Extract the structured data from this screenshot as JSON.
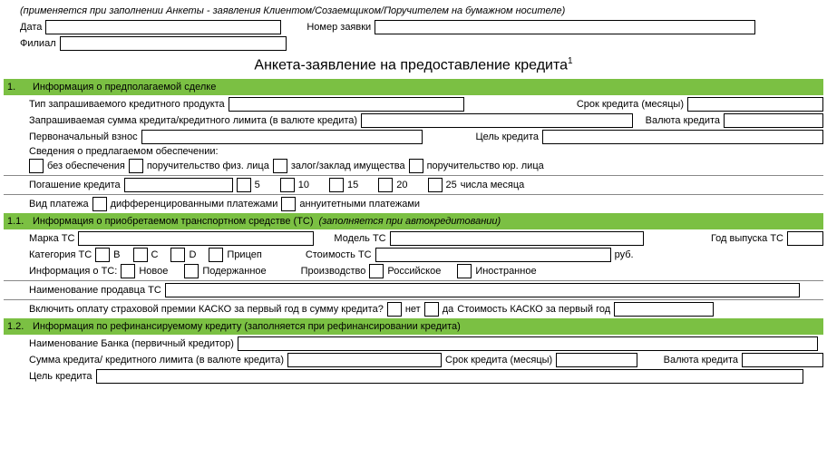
{
  "note_top": "(применяется при заполнении Анкеты - заявления Клиентом/Созаемщиком/Поручителем на бумажном носителе)",
  "header": {
    "date_label": "Дата",
    "app_number_label": "Номер заявки",
    "branch_label": "Филиал"
  },
  "title": "Анкета-заявление на предоставление кредита",
  "title_sup": "1",
  "section1": {
    "num": "1.",
    "label": "Информация о предполагаемой сделке",
    "product_type": "Тип запрашиваемого кредитного продукта",
    "loan_term": "Срок кредита (месяцы)",
    "req_amount": "Запрашиваемая сумма кредита/кредитного лимита (в валюте кредита)",
    "currency": "Валюта кредита",
    "down_payment": "Первоначальный взнос",
    "purpose": "Цель кредита",
    "collateral_info": "Сведения о предлагаемом обеспечении:",
    "no_collateral": "без обеспечения",
    "guarantee_person": "поручительство физ. лица",
    "pledge": "залог/заклад имущества",
    "guarantee_legal": "поручительство юр. лица",
    "repayment": "Погашение кредита",
    "day5": "5",
    "day10": "10",
    "day15": "15",
    "day20": "20",
    "day25": "25",
    "day_suffix": "числа месяца",
    "payment_type": "Вид платежа",
    "differentiated": "дифференцированными платежами",
    "annuity": "аннуитетными платежами"
  },
  "section11": {
    "num": "1.1.",
    "label": "Информация о приобретаемом транспортном средстве (ТС)",
    "note": "(заполняется при автокредитовании)",
    "brand": "Марка ТС",
    "model": "Модель ТС",
    "year": "Год выпуска ТС",
    "category": "Категория ТС",
    "catB": "B",
    "catC": "C",
    "catD": "D",
    "trailer": "Прицеп",
    "cost": "Стоимость ТС",
    "rub": "руб.",
    "info_tc": "Информация о ТС:",
    "new": "Новое",
    "used": "Подержанное",
    "production": "Производство",
    "russian": "Российское",
    "foreign": "Иностранное",
    "seller": "Наименование продавца ТС",
    "kasko_q": "Включить оплату страховой премии КАСКО за первый год в сумму кредита?",
    "no": "нет",
    "yes": "да",
    "kasko_cost": "Стоимость КАСКО за первый год"
  },
  "section12": {
    "num": "1.2.",
    "label": "Информация по рефинансируемому кредиту (заполняется при рефинансировании кредита)",
    "bank_name": "Наименование Банка (первичный кредитор)",
    "amount": "Сумма кредита/ кредитного лимита (в валюте кредита)",
    "term": "Срок кредита (месяцы)",
    "currency": "Валюта кредита",
    "purpose": "Цель кредита"
  }
}
